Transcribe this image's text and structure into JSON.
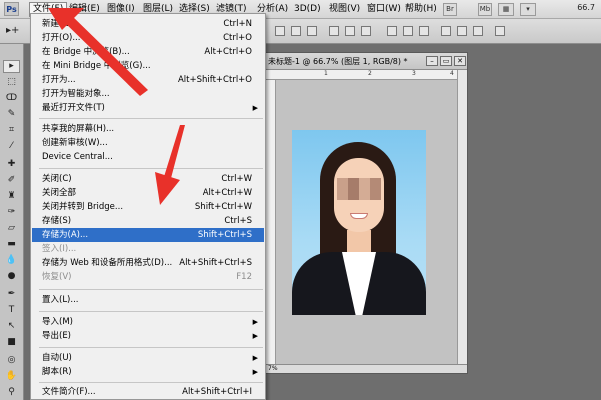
{
  "app": {
    "logo": "Ps",
    "menus": [
      "文件(F)",
      "编辑(E)",
      "图像(I)",
      "图层(L)",
      "选择(S)",
      "滤镜(T)",
      "分析(A)",
      "3D(D)",
      "视图(V)",
      "窗口(W)",
      "帮助(H)"
    ],
    "toolbar_buttons": [
      "Br",
      "Mb"
    ],
    "zoom": "66.7"
  },
  "document": {
    "title": "未标题-1 @ 66.7% (图层 1, RGB/8) *",
    "ruler_labels": [
      "1",
      "2",
      "3",
      "4"
    ],
    "status_zoom": "7%"
  },
  "file_menu": {
    "items": [
      {
        "label": "新建(N)...",
        "shortcut": "Ctrl+N"
      },
      {
        "label": "打开(O)...",
        "shortcut": "Ctrl+O"
      },
      {
        "label": "在 Bridge 中浏览(B)...",
        "shortcut": "Alt+Ctrl+O"
      },
      {
        "label": "在 Mini Bridge 中浏览(G)...",
        "shortcut": ""
      },
      {
        "label": "打开为...",
        "shortcut": "Alt+Shift+Ctrl+O"
      },
      {
        "label": "打开为智能对象...",
        "shortcut": ""
      },
      {
        "label": "最近打开文件(T)",
        "shortcut": ""
      },
      {
        "label": "共享我的屏幕(H)...",
        "shortcut": ""
      },
      {
        "label": "创建新审核(W)...",
        "shortcut": ""
      },
      {
        "label": "Device Central...",
        "shortcut": ""
      },
      {
        "label": "关闭(C)",
        "shortcut": "Ctrl+W"
      },
      {
        "label": "关闭全部",
        "shortcut": "Alt+Ctrl+W"
      },
      {
        "label": "关闭并转到 Bridge...",
        "shortcut": "Shift+Ctrl+W"
      },
      {
        "label": "存储(S)",
        "shortcut": "Ctrl+S"
      },
      {
        "label": "存储为(A)...",
        "shortcut": "Shift+Ctrl+S"
      },
      {
        "label": "签入(I)...",
        "shortcut": ""
      },
      {
        "label": "存储为 Web 和设备所用格式(D)...",
        "shortcut": "Alt+Shift+Ctrl+S"
      },
      {
        "label": "恢复(V)",
        "shortcut": "F12"
      },
      {
        "label": "置入(L)...",
        "shortcut": ""
      },
      {
        "label": "导入(M)",
        "shortcut": ""
      },
      {
        "label": "导出(E)",
        "shortcut": ""
      },
      {
        "label": "自动(U)",
        "shortcut": ""
      },
      {
        "label": "脚本(R)",
        "shortcut": ""
      },
      {
        "label": "文件简介(F)...",
        "shortcut": "Alt+Shift+Ctrl+I"
      }
    ]
  },
  "colors": {
    "highlight": "#2f6fc8",
    "annotation_arrow": "#e8312a"
  }
}
